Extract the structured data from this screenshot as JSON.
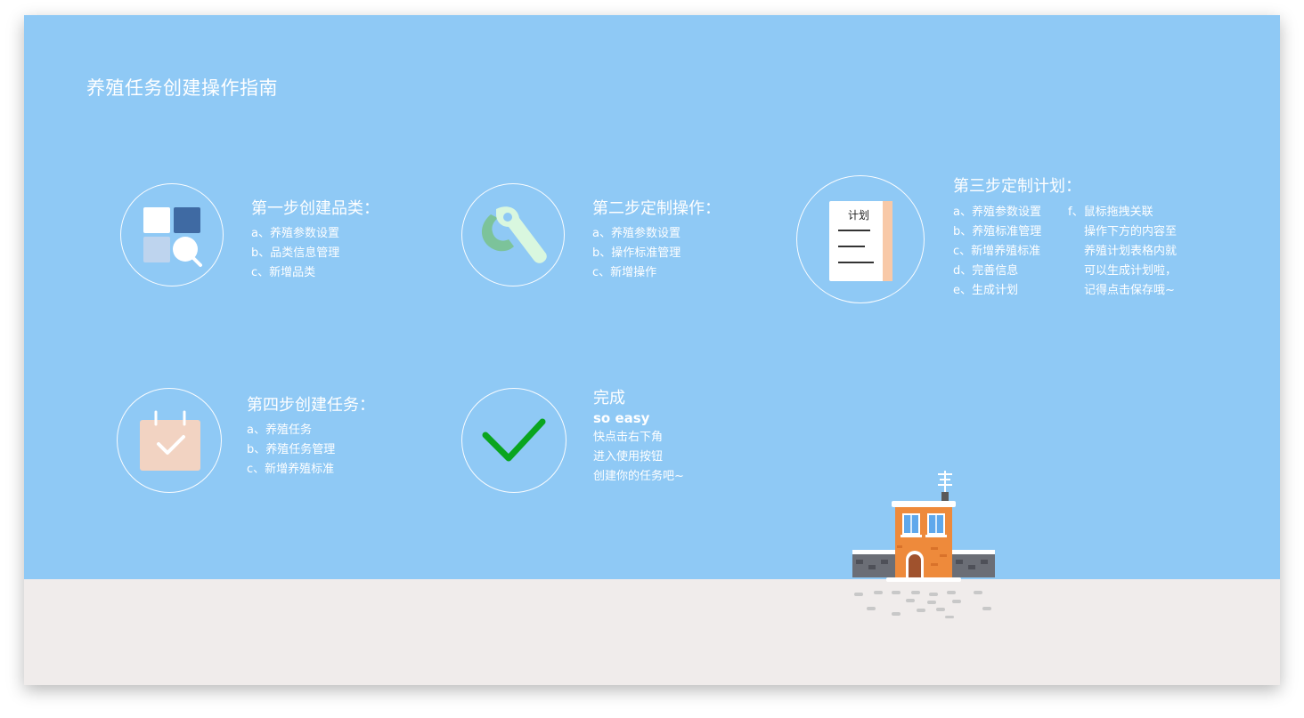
{
  "page": {
    "title": "养殖任务创建操作指南"
  },
  "steps": {
    "step1": {
      "title": "第一步创建品类：",
      "items": [
        "a、养殖参数设置",
        "b、品类信息管理",
        "c、新增品类"
      ]
    },
    "step2": {
      "title": "第二步定制操作：",
      "items": [
        "a、养殖参数设置",
        "b、操作标准管理",
        "c、新增操作"
      ]
    },
    "step3": {
      "title": "第三步定制计划：",
      "items_left": [
        "a、养殖参数设置",
        "b、养殖标准管理",
        "c、新增养殖标准",
        "d、完善信息",
        "e、生成计划"
      ],
      "items_right": [
        "f、鼠标拖拽关联",
        "操作下方的内容至",
        "养殖计划表格内就",
        "可以生成计划啦，",
        "记得点击保存哦~"
      ],
      "doc_label": "计划"
    },
    "step4": {
      "title": "第四步创建任务：",
      "items": [
        "a、养殖任务",
        "b、养殖任务管理",
        "c、新增养殖标准"
      ]
    },
    "done": {
      "title": "完成",
      "subtitle": "so easy",
      "lines": [
        "快点击右下角",
        "进入使用按钮",
        "创建你的任务吧~"
      ]
    }
  },
  "icons": {
    "step1": "category-grid-search-icon",
    "step2": "wrench-icon",
    "step3": "plan-document-icon",
    "step4": "calendar-check-icon",
    "done": "checkmark-icon",
    "decoration": "house-illustration"
  },
  "colors": {
    "background": "#8fc9f5",
    "ground": "#f0eceb",
    "text": "#ffffff",
    "check_green": "#0aa51f",
    "wrench_dark": "#7cc39a",
    "wrench_light": "#d9f7df",
    "grid_dark": "#3f6aa3",
    "grid_light": "#bed4ee",
    "calendar": "#f2d3c2",
    "house_orange": "#ee8a3b"
  }
}
